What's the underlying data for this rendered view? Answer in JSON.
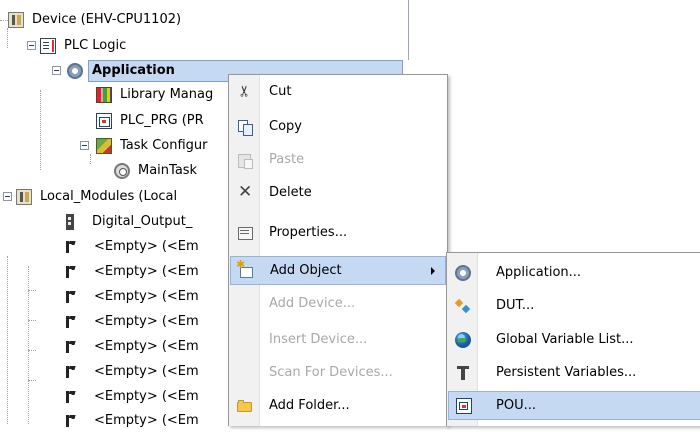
{
  "tree": {
    "device": "Device (EHV-CPU1102)",
    "plc_logic": "PLC Logic",
    "application": "Application",
    "library_manager": "Library Manag",
    "plc_prg": "PLC_PRG (PR",
    "task_configuration": "Task Configur",
    "main_task": "MainTask",
    "local_modules": "Local_Modules (Local",
    "digital_output": "Digital_Output_",
    "empty_slots": [
      "<Empty> (<Em",
      "<Empty> (<Em",
      "<Empty> (<Em",
      "<Empty> (<Em",
      "<Empty> (<Em",
      "<Empty> (<Em",
      "<Empty> (<Em",
      "<Empty> (<Em"
    ]
  },
  "context_menu": {
    "items": [
      {
        "label": "Cut",
        "icon": "cut-icon",
        "enabled": true
      },
      {
        "label": "Copy",
        "icon": "copy-icon",
        "enabled": true
      },
      {
        "label": "Paste",
        "icon": "paste-icon",
        "enabled": false
      },
      {
        "label": "Delete",
        "icon": "delete-icon",
        "enabled": true
      },
      {
        "label": "Properties...",
        "icon": "properties-icon",
        "enabled": true
      },
      {
        "label": "Add Object",
        "icon": "add-object-icon",
        "enabled": true,
        "highlighted": true,
        "submenu": true
      },
      {
        "label": "Add Device...",
        "enabled": false
      },
      {
        "label": "Insert Device...",
        "enabled": false
      },
      {
        "label": "Scan For Devices...",
        "enabled": false
      },
      {
        "label": "Add Folder...",
        "icon": "folder-icon",
        "enabled": true
      }
    ]
  },
  "submenu": {
    "items": [
      {
        "label": "Application...",
        "icon": "application-icon"
      },
      {
        "label": "DUT...",
        "icon": "dut-icon"
      },
      {
        "label": "Global Variable List...",
        "icon": "global-variable-list-icon"
      },
      {
        "label": "Persistent Variables...",
        "icon": "persistent-variables-icon"
      },
      {
        "label": "POU...",
        "icon": "pou-icon",
        "highlighted": true
      }
    ]
  },
  "colors": {
    "selection": "#c6d9f2",
    "disabled_text": "#a8a8a8"
  }
}
